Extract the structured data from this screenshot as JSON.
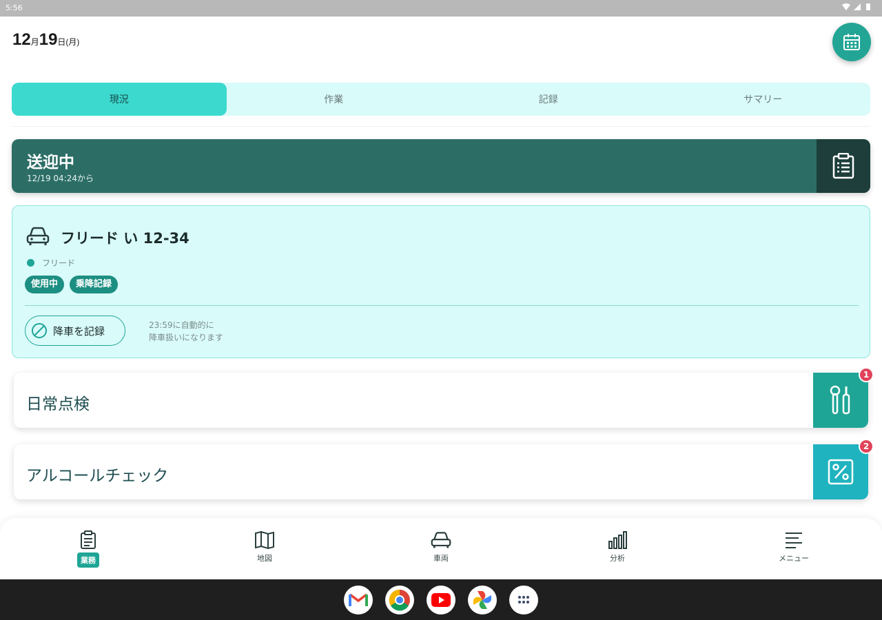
{
  "status_bar": {
    "time": "5:56"
  },
  "header": {
    "month": "12",
    "month_suffix": "月",
    "day": "19",
    "day_suffix": "日(月)"
  },
  "tabs": [
    {
      "label": "現況",
      "active": true
    },
    {
      "label": "作業",
      "active": false
    },
    {
      "label": "記録",
      "active": false
    },
    {
      "label": "サマリー",
      "active": false
    }
  ],
  "status_card": {
    "title": "送迎中",
    "since": "12/19 04:24から"
  },
  "vehicle": {
    "name": "フリード い 12-34",
    "type": "フリード",
    "chips": [
      "使用中",
      "乗降記録"
    ],
    "record_button": "降車を記録",
    "auto_note_line1": "23:59に自動的に",
    "auto_note_line2": "降車扱いになります"
  },
  "tasks": [
    {
      "label": "日常点検",
      "badge": "1"
    },
    {
      "label": "アルコールチェック",
      "badge": "2"
    }
  ],
  "bottom_nav": [
    {
      "label": "業務",
      "icon": "clipboard-icon",
      "active": true
    },
    {
      "label": "地図",
      "icon": "map-icon",
      "active": false
    },
    {
      "label": "車両",
      "icon": "car-icon",
      "active": false
    },
    {
      "label": "分析",
      "icon": "bar-chart-icon",
      "active": false
    },
    {
      "label": "メニュー",
      "icon": "menu-lines-icon",
      "active": false
    }
  ],
  "dock_apps": [
    "gmail-icon",
    "chrome-icon",
    "youtube-icon",
    "photos-icon",
    "app-drawer-icon"
  ],
  "colors": {
    "accent": "#1fa596",
    "status_dark": "#2c6e66",
    "tab_active": "#3cd9cf",
    "badge": "#e0435a"
  }
}
